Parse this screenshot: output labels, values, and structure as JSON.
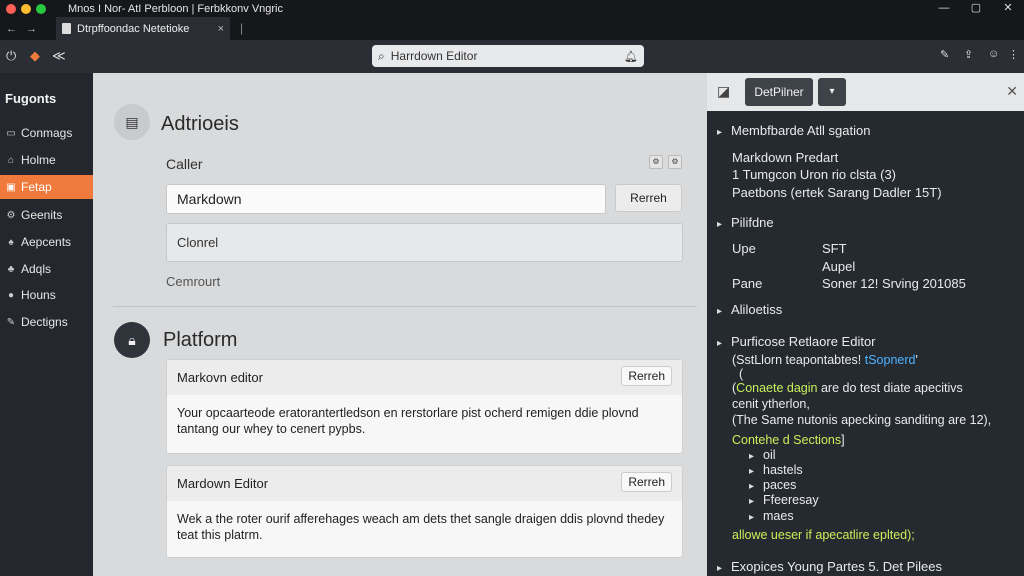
{
  "colors": {
    "accent": "#f07a3c",
    "dot_red": "#ff5f57",
    "dot_yellow": "#febc2e",
    "dot_green": "#28c840"
  },
  "window": {
    "title": "Mnos I Nor- AtI Perbloon | Ferbkkonv Vngric",
    "controls": [
      "—",
      "▢",
      "✕"
    ]
  },
  "tab": {
    "title": "Dtrpffoondac Netetioke",
    "close": "×",
    "sep": "|"
  },
  "address": {
    "text": "Harrdown Editor"
  },
  "sidebar": {
    "heading": "Fugonts",
    "items": [
      {
        "label": "Conmags",
        "icon": "chat-icon"
      },
      {
        "label": "Holme",
        "icon": "home-icon"
      },
      {
        "label": "Fetap",
        "icon": "tag-icon"
      },
      {
        "label": "Geenits",
        "icon": "gear-icon"
      },
      {
        "label": "Aepcents",
        "icon": "user-icon"
      },
      {
        "label": "Adqls",
        "icon": "puzzle-icon"
      },
      {
        "label": "Houns",
        "icon": "clock-icon"
      },
      {
        "label": "Dectigns",
        "icon": "pencil-icon"
      }
    ]
  },
  "main": {
    "section1": {
      "title": "Adtrioeis",
      "caller_label": "Caller",
      "input_value": "Markdown",
      "button": "Rerreh",
      "select_value": "Clonrel",
      "cemrourt_label": "Cemrourt"
    },
    "section2": {
      "title": "Platform",
      "cards": [
        {
          "title": "Markovn editor",
          "button": "Rerreh",
          "body": "Your opcaarteode eratorantertledson en rerstorlare pist ocherd remigen ddie plovnd tantang our whey to cenert pypbs."
        },
        {
          "title": "Mardown Editor",
          "button": "Rerreh",
          "body": "Wek a the roter ourif afferehages weach am dets thet sangle draigen ddis plovnd thedey teat this platrm."
        }
      ]
    }
  },
  "rpanel": {
    "tab": "DetPilner",
    "lines": {
      "l1": "Membfbarde Atll sgation",
      "l2": "Markdown Predart",
      "l3": "1 Tumgcon Uron rio clsta (3)",
      "l4": "Paetbons (ertek Sarang Dadler 15T)",
      "l5": "Pilifdne",
      "l6a": "Upe",
      "l6b": "SFT",
      "l7": "Aupel",
      "l8a": "Pane",
      "l8b": "Soner 12! Srving 201085",
      "l9": "Aliloetiss",
      "l10": "Purficose Retlaore Editor",
      "l11a": "(SstLlorn teapontabtes! ",
      "l11b": "tSopnerd",
      "l11c": "'",
      "l12": "(",
      "l13a": "(",
      "l13b": "Conaete dagin",
      "l13c": " are do test diate apecitivs",
      "l14": "cenit ytherlon,",
      "l15": "(The Same nutonis apecking sanditing are 12),",
      "l16": "Contehe d Sections",
      "l16b": "]",
      "bullets": [
        "oil",
        "hastels",
        "paces",
        "Ffeeresay",
        "maes"
      ],
      "l22": "allowe ueser if apecatlire eplted);",
      "l23": "Exopices Young Partes 5. Det Pilees"
    }
  }
}
